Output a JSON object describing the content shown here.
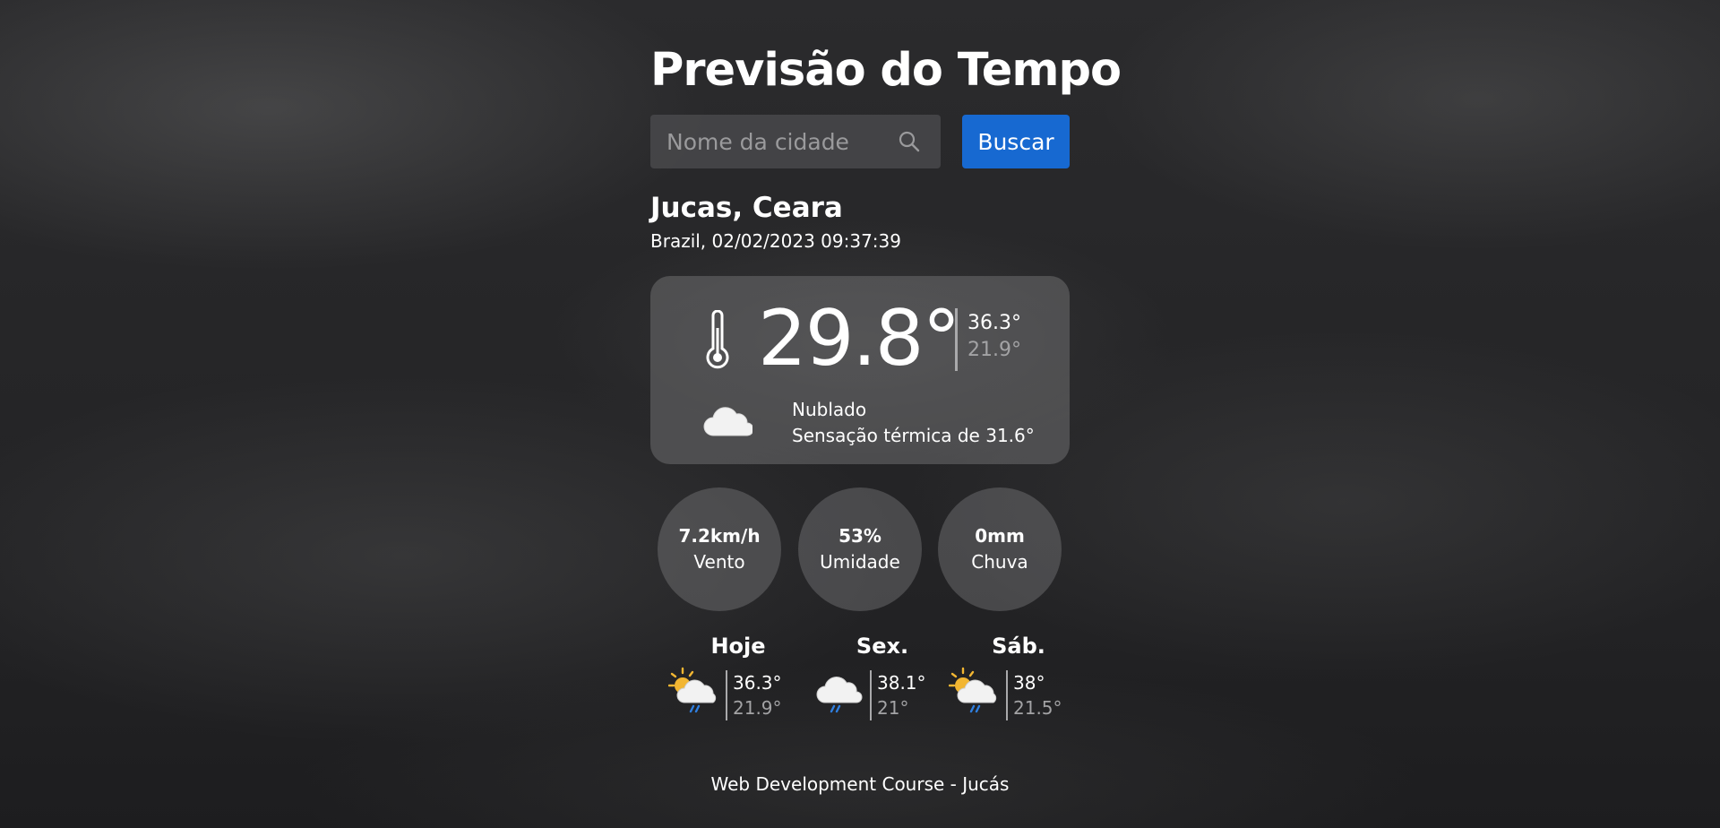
{
  "header": {
    "title": "Previsão do Tempo"
  },
  "search": {
    "placeholder": "Nome da cidade",
    "value": "",
    "icon": "search-icon",
    "button_label": "Buscar",
    "button_color": "#1769d1"
  },
  "location": {
    "city": "Jucas, Ceara",
    "country_date": "Brazil, 02/02/2023 09:37:39"
  },
  "current": {
    "icon": "thermometer-icon",
    "temperature": "29.8°",
    "max": "36.3°",
    "min": "21.9°",
    "condition_icon": "cloud-icon",
    "condition": "Nublado",
    "feels_like": "Sensação térmica de 31.6°"
  },
  "stats": [
    {
      "value": "7.2km/h",
      "label": "Vento"
    },
    {
      "value": "53%",
      "label": "Umidade"
    },
    {
      "value": "0mm",
      "label": "Chuva"
    }
  ],
  "forecast": [
    {
      "day": "Hoje",
      "icon": "sun-cloud-rain-icon",
      "max": "36.3°",
      "min": "21.9°"
    },
    {
      "day": "Sex.",
      "icon": "cloud-rain-icon",
      "max": "38.1°",
      "min": "21°"
    },
    {
      "day": "Sáb.",
      "icon": "sun-cloud-rain-icon",
      "max": "38°",
      "min": "21.5°"
    }
  ],
  "footer": {
    "text": "Web Development Course - Jucás"
  }
}
